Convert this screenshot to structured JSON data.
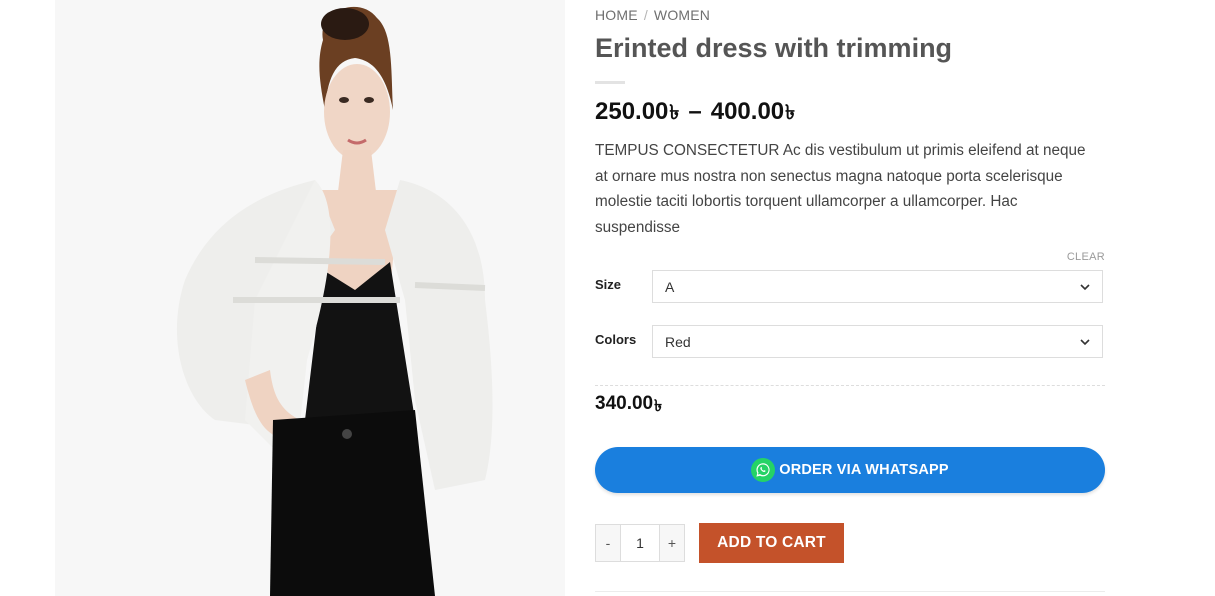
{
  "breadcrumb": {
    "home": "HOME",
    "separator": "/",
    "category": "WOMEN"
  },
  "product": {
    "title": "Erinted dress with trimming",
    "price_min": "250.00",
    "price_max": "400.00",
    "currency_symbol": "৳",
    "range_separator": "–",
    "description": "TEMPUS CONSECTETUR Ac dis vestibulum ut primis eleifend at neque at ornare mus nostra non senectus magna natoque porta scelerisque molestie taciti lobortis torquent ullamcorper a ullamcorper. Hac suspendisse",
    "image_alt": "Model wearing white fringed jacket over black top and trousers"
  },
  "variations": {
    "clear_label": "CLEAR",
    "size_label": "Size",
    "size_value": "A",
    "colors_label": "Colors",
    "colors_value": "Red"
  },
  "selected_price": "340.00",
  "actions": {
    "whatsapp_label": "ORDER VIA WHATSAPP",
    "quantity": "1",
    "minus": "-",
    "plus": "+",
    "add_to_cart_label": "ADD TO CART"
  },
  "colors": {
    "whatsapp_button": "#1a7fde",
    "add_to_cart": "#c4522a",
    "whatsapp_icon": "#25d366"
  },
  "icons": {
    "dropdown": "chevron-down-icon",
    "whatsapp": "whatsapp-icon"
  }
}
